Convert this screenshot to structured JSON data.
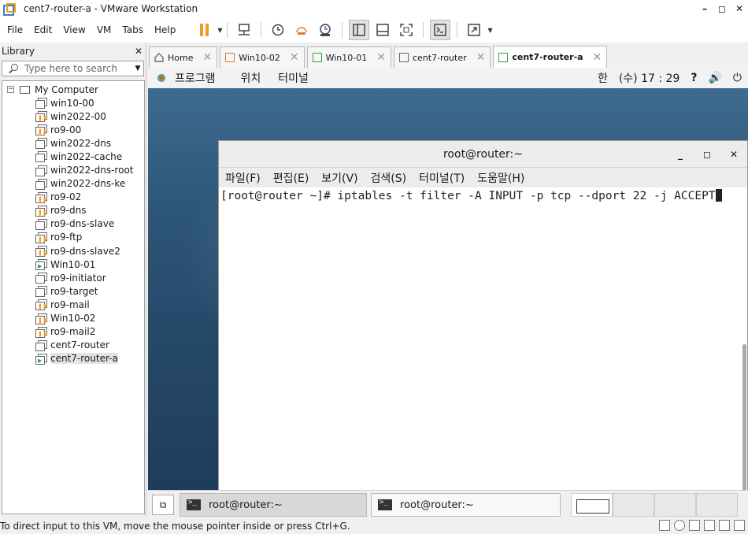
{
  "window": {
    "title": "cent7-router-a - VMware Workstation",
    "minimize": "–",
    "maximize": "◻",
    "close": "✕"
  },
  "menu": [
    "File",
    "Edit",
    "View",
    "VM",
    "Tabs",
    "Help"
  ],
  "library": {
    "title": "Library",
    "close": "✕",
    "search_placeholder": "Type here to search",
    "root": "My Computer",
    "toggle": "⊟",
    "vms": [
      {
        "name": "win10-00",
        "state": "off"
      },
      {
        "name": "win2022-00",
        "state": "paused"
      },
      {
        "name": "ro9-00",
        "state": "paused"
      },
      {
        "name": "win2022-dns",
        "state": "off"
      },
      {
        "name": "win2022-cache",
        "state": "off"
      },
      {
        "name": "win2022-dns-root",
        "state": "off"
      },
      {
        "name": "win2022-dns-ke",
        "state": "off"
      },
      {
        "name": "ro9-02",
        "state": "paused"
      },
      {
        "name": "ro9-dns",
        "state": "paused"
      },
      {
        "name": "ro9-dns-slave",
        "state": "off"
      },
      {
        "name": "ro9-ftp",
        "state": "paused"
      },
      {
        "name": "ro9-dns-slave2",
        "state": "paused"
      },
      {
        "name": "Win10-01",
        "state": "running"
      },
      {
        "name": "ro9-initiator",
        "state": "off"
      },
      {
        "name": "ro9-target",
        "state": "off"
      },
      {
        "name": "ro9-mail",
        "state": "paused"
      },
      {
        "name": "Win10-02",
        "state": "paused"
      },
      {
        "name": "ro9-mail2",
        "state": "paused"
      },
      {
        "name": "cent7-router",
        "state": "off"
      },
      {
        "name": "cent7-router-a",
        "state": "running",
        "selected": true
      }
    ]
  },
  "tabs": [
    {
      "label": "Home",
      "close": "✕"
    },
    {
      "label": "Win10-02",
      "close": "✕"
    },
    {
      "label": "Win10-01",
      "close": "✕"
    },
    {
      "label": "cent7-router",
      "close": "✕"
    },
    {
      "label": "cent7-router-a",
      "close": "✕",
      "active": true
    }
  ],
  "guest": {
    "topbar": {
      "applications": "프로그램",
      "places": "위치",
      "terminal": "터미널",
      "ime": "한",
      "clock": "(수) 17 : 29",
      "net": "?",
      "volume": "🔊",
      "power": "⏻"
    },
    "terminal": {
      "title": "root@router:~",
      "min": "_",
      "max": "◻",
      "close": "✕",
      "menu": [
        "파일(F)",
        "편집(E)",
        "보기(V)",
        "검색(S)",
        "터미널(T)",
        "도움말(H)"
      ],
      "prompt": "[root@router ~]# ",
      "command": "iptables -t filter -A INPUT -p tcp --dport 22 -j ACCEPT"
    },
    "taskbar": {
      "show_desktop": "⧉",
      "items": [
        "root@router:~",
        "root@router:~"
      ]
    }
  },
  "statusbar": {
    "text": "To direct input to this VM, move the mouse pointer inside or press Ctrl+G."
  }
}
